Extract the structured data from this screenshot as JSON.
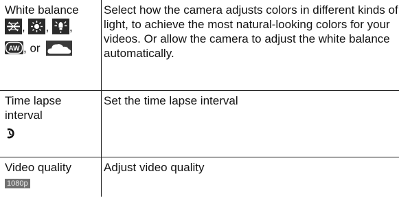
{
  "rows": [
    {
      "setting": "White balance",
      "icons": [
        "tungsten-icon",
        "daylight-icon",
        "fluorescent-icon",
        "auto-white-balance-icon",
        "cloudy-icon"
      ],
      "sep_comma": ",",
      "or_text": ", or",
      "description": "Select how the camera adjusts colors in different kinds of light, to achieve the most natural-looking colors for your videos. Or allow the camera to adjust the white balance automatically."
    },
    {
      "setting": "Time lapse interval",
      "icons": [
        "time-lapse-icon"
      ],
      "description": "Set the time lapse interval"
    },
    {
      "setting": "Video quality",
      "badge": "1080p",
      "description": "Adjust video quality"
    }
  ],
  "aw_label": "AW",
  "colors": {
    "border": "#1a1a1a",
    "icon_bg": "#2b2b2b",
    "badge_bg": "#707070"
  }
}
